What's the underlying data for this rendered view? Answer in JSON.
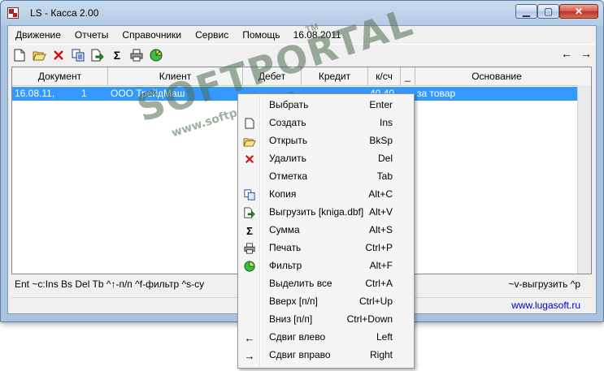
{
  "window": {
    "title": "LS - Касса 2.00"
  },
  "menubar": {
    "items": [
      "Движение",
      "Отчеты",
      "Справочники",
      "Сервис",
      "Помощь"
    ],
    "date": "16.08.2011"
  },
  "toolbar": {
    "left_arrow": "←",
    "right_arrow": "→"
  },
  "grid": {
    "columns": [
      "Документ",
      "Клиент",
      "Дебет",
      "Кредит",
      "к/сч",
      "_",
      "Основание"
    ],
    "selected_row": {
      "date": "16.08.11,",
      "num": "1",
      "client": "ООО ТрейдМаш",
      "account": "40.40",
      "basis": "за товар"
    }
  },
  "status": {
    "left": "Ent ~c:Ins Bs Del Tb ^↑-п/п ^f-фильтр ^s-су",
    "right": "~v-выгрузить ^p",
    "url": "www.lugasoft.ru"
  },
  "watermark": {
    "main": "SOFTPORTAL",
    "sub": "www.softportal.com",
    "tm": "TM"
  },
  "context_menu": {
    "items": [
      {
        "label": "Выбрать",
        "key": "Enter",
        "icon": ""
      },
      {
        "label": "Создать",
        "key": "Ins",
        "icon": "new-doc-icon"
      },
      {
        "label": "Открыть",
        "key": "BkSp",
        "icon": "open-folder-icon"
      },
      {
        "label": "Удалить",
        "key": "Del",
        "icon": "delete-x-icon"
      },
      {
        "label": "Отметка",
        "key": "Tab",
        "icon": ""
      },
      {
        "label": "Копия",
        "key": "Alt+C",
        "icon": "copy-icon"
      },
      {
        "label": "Выгрузить [kniga.dbf]",
        "key": "Alt+V",
        "icon": "export-icon"
      },
      {
        "label": "Сумма",
        "key": "Alt+S",
        "icon": "sigma-icon"
      },
      {
        "label": "Печать",
        "key": "Ctrl+P",
        "icon": "printer-icon"
      },
      {
        "label": "Фильтр",
        "key": "Alt+F",
        "icon": "filter-icon"
      },
      {
        "label": "Выделить все",
        "key": "Ctrl+A",
        "icon": ""
      },
      {
        "label": "Вверх [п/п]",
        "key": "Ctrl+Up",
        "icon": ""
      },
      {
        "label": "Вниз [п/п]",
        "key": "Ctrl+Down",
        "icon": ""
      },
      {
        "label": "Сдвиг влево",
        "key": "Left",
        "icon": "arrow-left-icon"
      },
      {
        "label": "Сдвиг вправо",
        "key": "Right",
        "icon": "arrow-right-icon"
      }
    ]
  }
}
